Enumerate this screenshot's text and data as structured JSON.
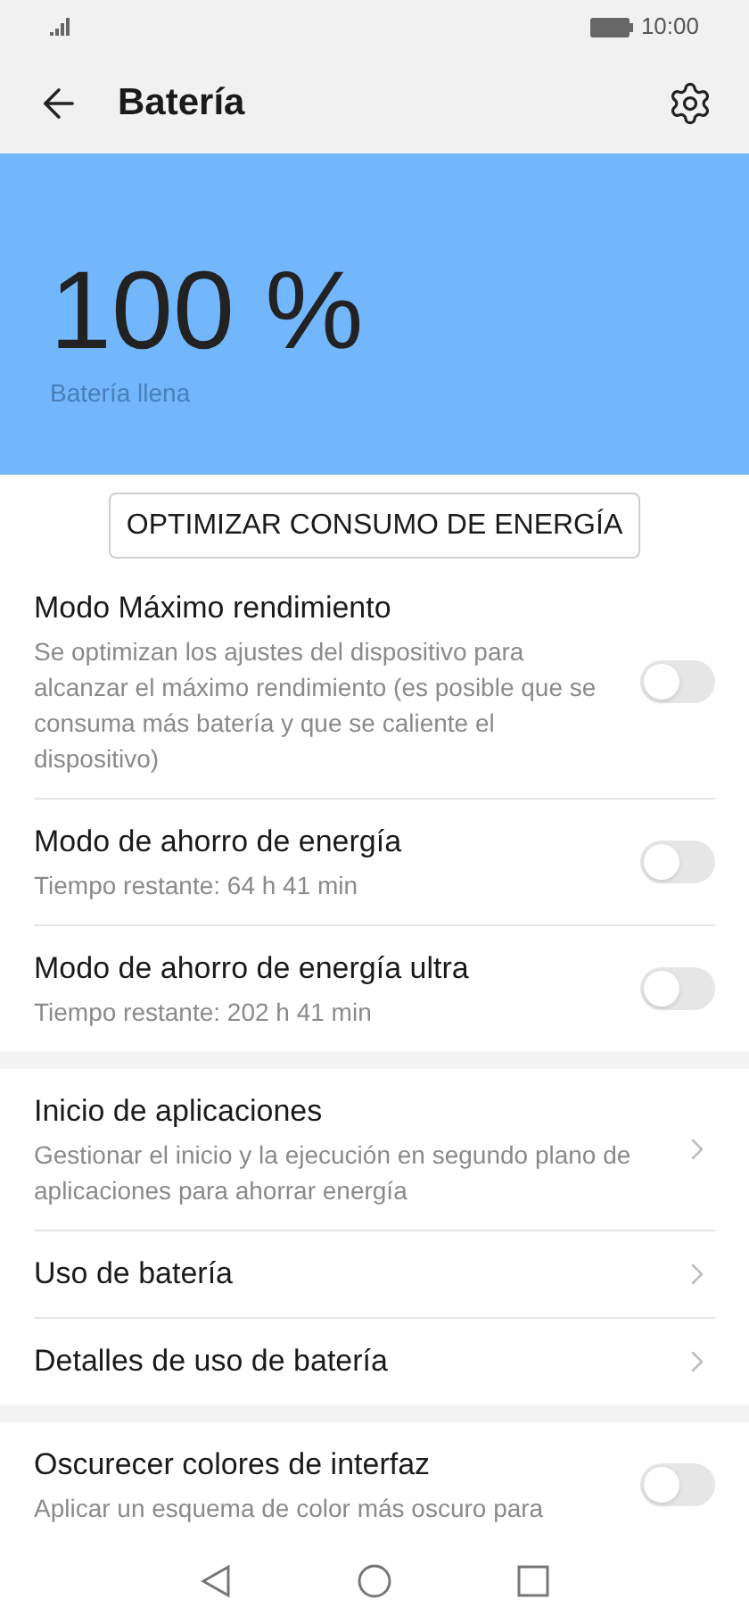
{
  "status_bar": {
    "time": "10:00"
  },
  "header": {
    "title": "Batería"
  },
  "battery": {
    "percent": "100 %",
    "status": "Batería llena"
  },
  "optimize_button": "OPTIMIZAR CONSUMO DE ENERGÍA",
  "sections": [
    {
      "items": [
        {
          "kind": "toggle",
          "title": "Modo Máximo rendimiento",
          "subtitle": "Se optimizan los ajustes del dispositivo para alcanzar el máximo rendimiento (es posible que se consuma más batería y que se caliente el dispositivo)",
          "on": false
        },
        {
          "kind": "toggle",
          "title": "Modo de ahorro de energía",
          "subtitle": "Tiempo restante: 64 h 41 min",
          "on": false
        },
        {
          "kind": "toggle",
          "title": "Modo de ahorro de energía ultra",
          "subtitle": "Tiempo restante: 202 h 41 min",
          "on": false
        }
      ]
    },
    {
      "items": [
        {
          "kind": "link",
          "title": "Inicio de aplicaciones",
          "subtitle": "Gestionar el inicio y la ejecución en segundo plano de aplicaciones para ahorrar energía"
        },
        {
          "kind": "link",
          "title": "Uso de batería"
        },
        {
          "kind": "link",
          "title": "Detalles de uso de batería"
        }
      ]
    },
    {
      "items": [
        {
          "kind": "toggle",
          "title": "Oscurecer colores de interfaz",
          "subtitle": "Aplicar un esquema de color más oscuro para",
          "on": false
        }
      ]
    }
  ]
}
